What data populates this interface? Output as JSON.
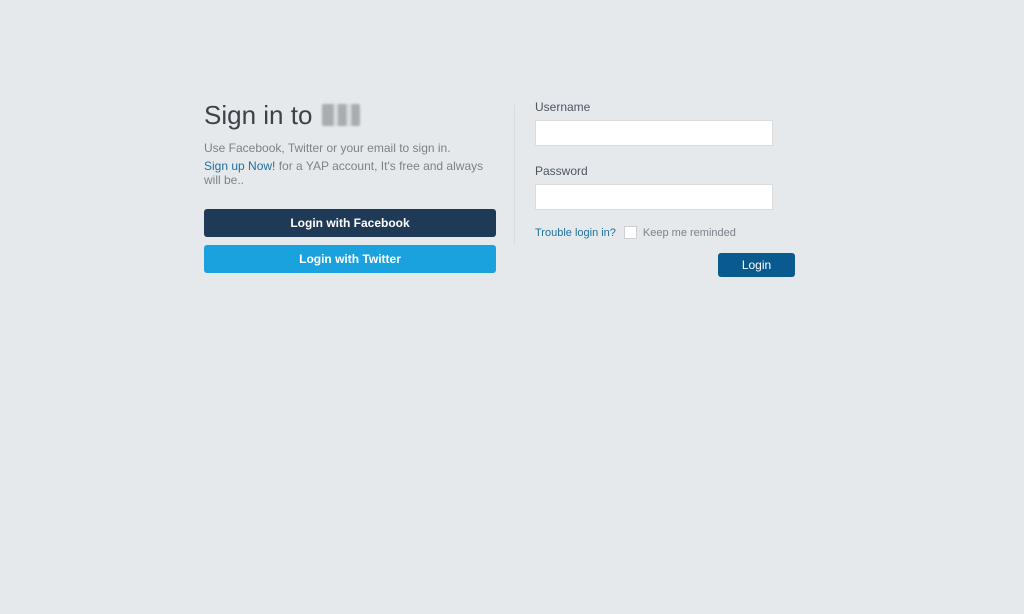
{
  "left": {
    "heading_prefix": "Sign in to ",
    "subtext": "Use Facebook, Twitter or your email to sign in.",
    "signup_link": "Sign up Now!",
    "signup_rest": " for a YAP account, It's free and always will be..",
    "facebook_btn": "Login with Facebook",
    "twitter_btn": "Login with Twitter"
  },
  "right": {
    "username_label": "Username",
    "username_value": "",
    "password_label": "Password",
    "password_value": "",
    "trouble_link": "Trouble login in?",
    "remind_label": "Keep me reminded",
    "login_btn": "Login"
  }
}
